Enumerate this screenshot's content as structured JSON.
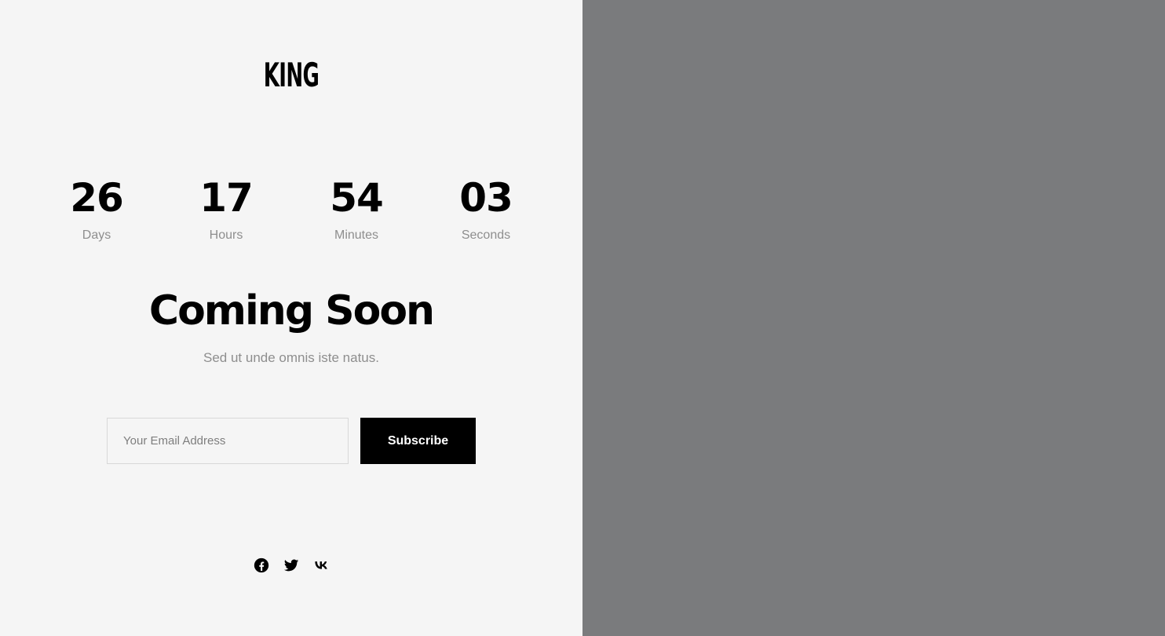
{
  "brand": {
    "logo_text": "KING"
  },
  "countdown": {
    "units": [
      {
        "value": "26",
        "label": "Days"
      },
      {
        "value": "17",
        "label": "Hours"
      },
      {
        "value": "54",
        "label": "Minutes"
      },
      {
        "value": "03",
        "label": "Seconds"
      }
    ]
  },
  "hero": {
    "title": "Coming Soon",
    "subtitle": "Sed ut unde omnis iste natus."
  },
  "subscribe": {
    "email_placeholder": "Your Email Address",
    "email_value": "",
    "button_label": "Subscribe"
  },
  "social": {
    "icons": [
      "facebook-icon",
      "twitter-icon",
      "vk-icon"
    ]
  },
  "colors": {
    "left_background": "#f5f5f5",
    "right_panel_background": "#7a7b7d",
    "text_primary": "#000000",
    "text_muted": "#8e8e8e",
    "button_background": "#000000",
    "button_text": "#ffffff"
  }
}
